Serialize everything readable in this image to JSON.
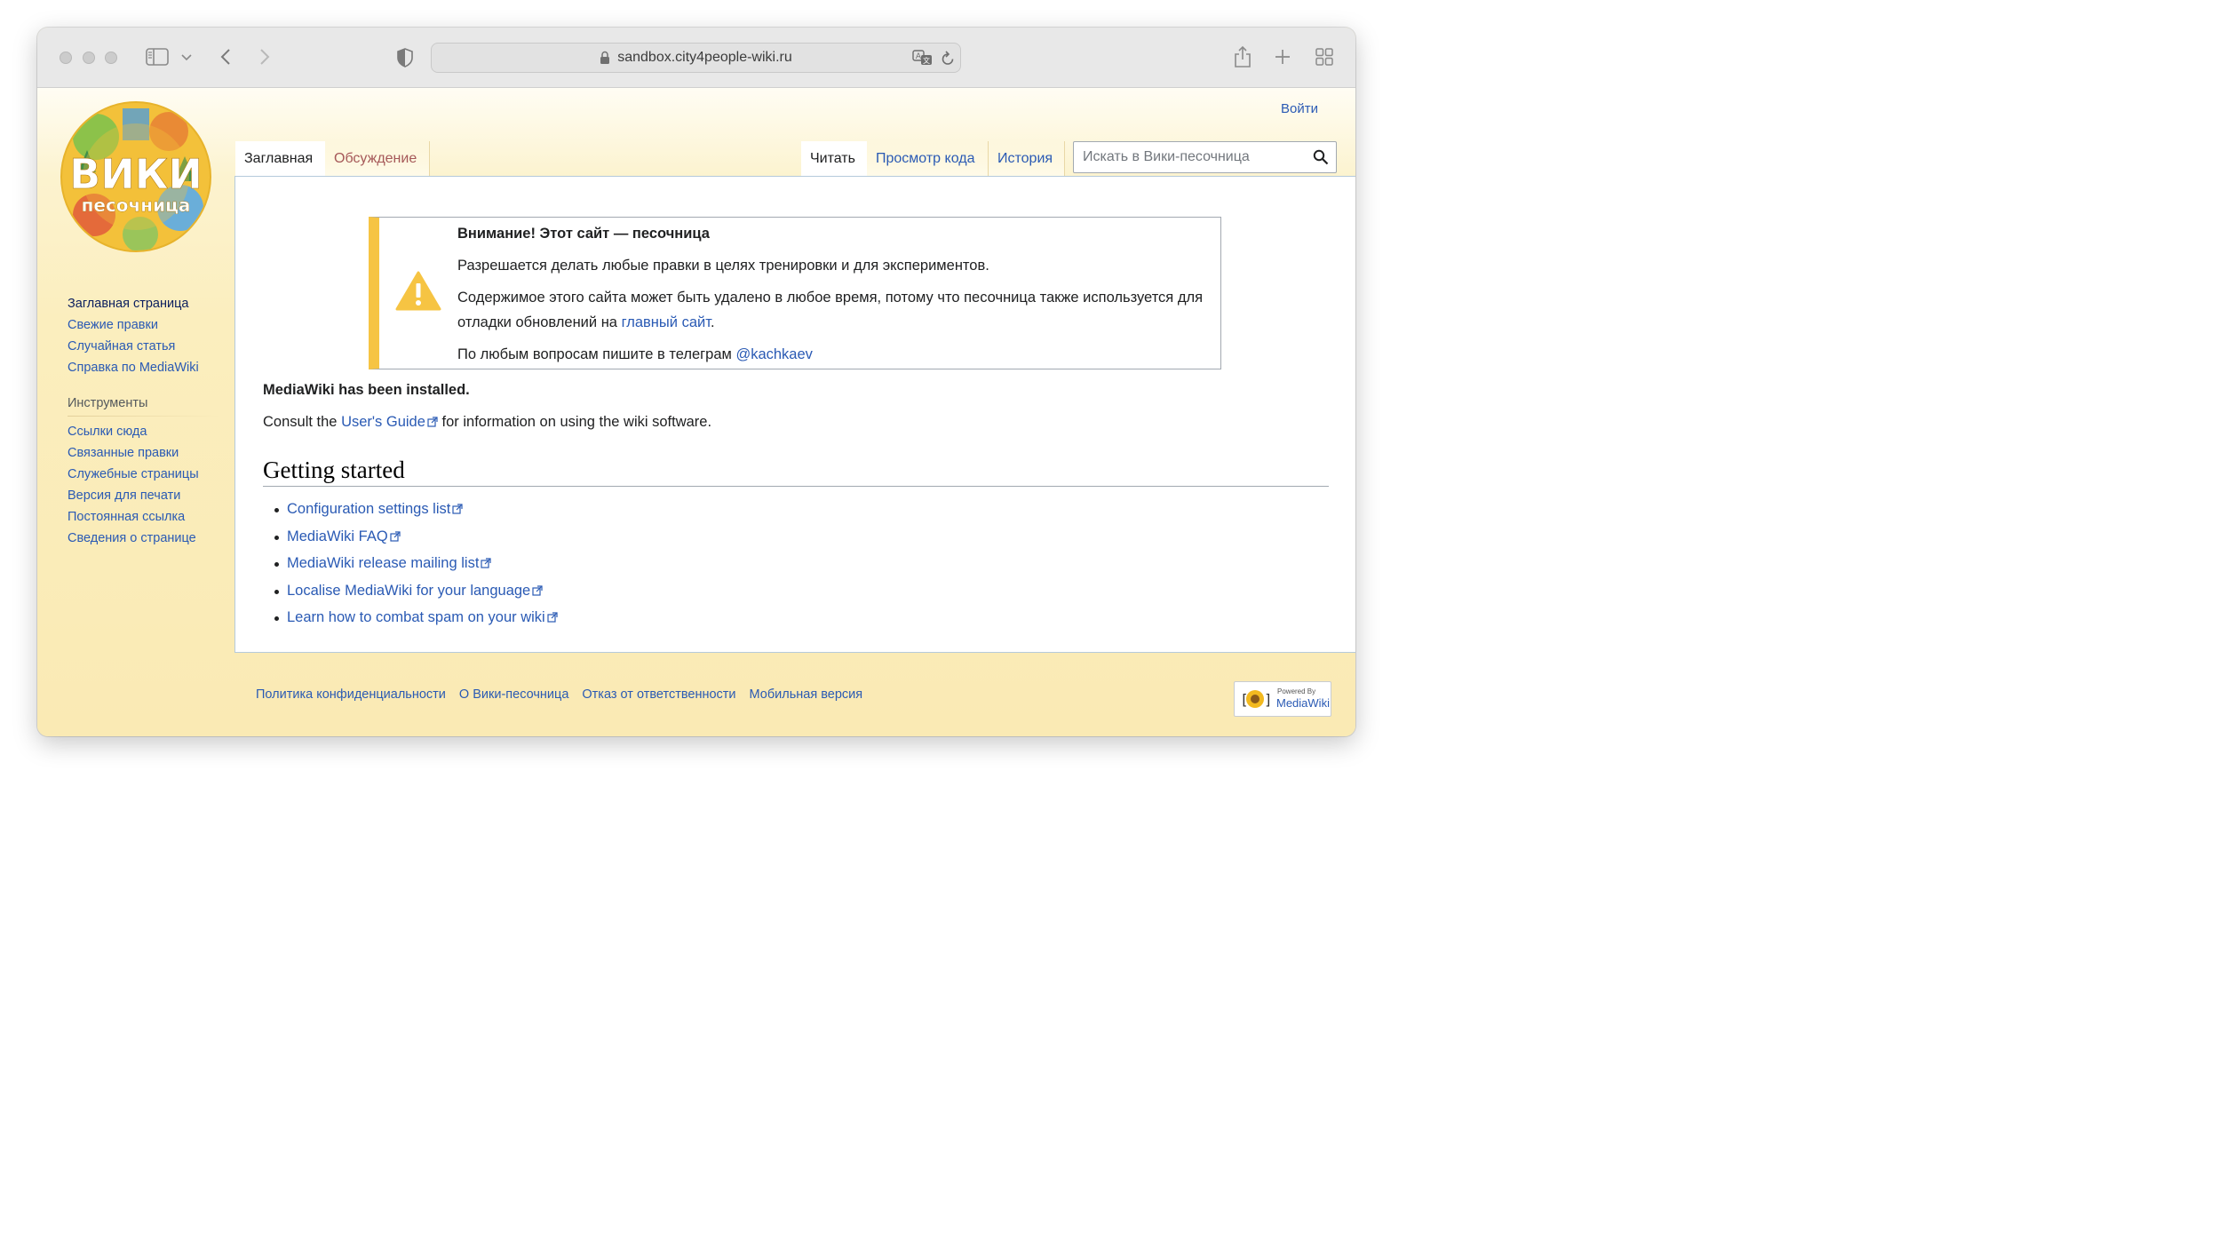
{
  "browser": {
    "url": "sandbox.city4people-wiki.ru",
    "icons": [
      "sidebar-icon",
      "chevron-down-icon",
      "back-icon",
      "forward-icon",
      "shield-icon",
      "lock-icon",
      "translate-icon",
      "reload-icon",
      "share-icon",
      "plus-icon",
      "tab-overview-icon"
    ]
  },
  "header": {
    "login": "Войти",
    "logo_line1": "ВИКИ",
    "logo_line2": "песочница"
  },
  "tabs": {
    "main": "Заглавная",
    "discussion": "Обсуждение",
    "read": "Читать",
    "view_source": "Просмотр кода",
    "history": "История"
  },
  "search": {
    "placeholder": "Искать в Вики-песочница"
  },
  "sidebar": {
    "nav": [
      "Заглавная страница",
      "Свежие правки",
      "Случайная статья",
      "Справка по MediaWiki"
    ],
    "tools_heading": "Инструменты",
    "tools": [
      "Ссылки сюда",
      "Связанные правки",
      "Служебные страницы",
      "Версия для печати",
      "Постоянная ссылка",
      "Сведения о странице"
    ]
  },
  "notice": {
    "title": "Внимание! Этот сайт — песочница",
    "line1": "Разрешается делать любые правки в целях тренировки и для экспериментов.",
    "line2_pre": "Содержимое этого сайта может быть удалено в любое время, потому что песочница также используется для отладки обновлений на ",
    "line2_link": "главный сайт",
    "line2_post": ".",
    "line3_pre": "По любым вопросам пишите в телеграм ",
    "line3_link": "@kachkaev"
  },
  "content": {
    "installed": "MediaWiki has been installed.",
    "consult_pre": "Consult the ",
    "consult_link": "User's Guide",
    "consult_post": " for information on using the wiki software.",
    "heading": "Getting started",
    "links": [
      "Configuration settings list",
      "MediaWiki FAQ",
      "MediaWiki release mailing list",
      "Localise MediaWiki for your language",
      "Learn how to combat spam on your wiki"
    ]
  },
  "footer": {
    "links": [
      "Политика конфиденциальности",
      "О Вики-песочница",
      "Отказ от ответственности",
      "Мобильная версия"
    ],
    "powered_line1": "Powered By",
    "powered_line2": "MediaWiki"
  },
  "colors": {
    "link": "#2a5ab4",
    "new_link": "#a55858",
    "notice_accent": "#f6c443",
    "sidebar_bg": "#fbeebe"
  }
}
